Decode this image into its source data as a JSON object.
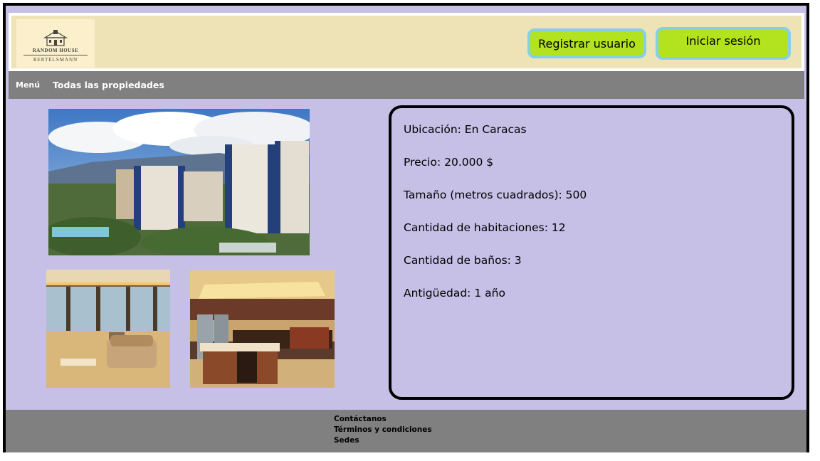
{
  "header": {
    "logo": {
      "line1": "RANDOM HOUSE",
      "line2": "BERTELSMANN",
      "icon": "house-logo-icon"
    },
    "register_label": "Registrar usuario",
    "login_label": "Iniciar sesión",
    "colors": {
      "header_bg": "#ede3b6",
      "button_bg": "#b3e21e",
      "button_border": "#86cfe6"
    }
  },
  "nav": {
    "menu_label": "Menú",
    "all_properties_label": "Todas las propiedades"
  },
  "gallery": {
    "images": [
      "building-exterior-photo",
      "living-room-photo",
      "kitchen-photo"
    ]
  },
  "details": {
    "location": "Ubicación: En Caracas",
    "price": "Precio: 20.000 $",
    "size": "Tamaño (metros cuadrados): 500",
    "rooms": "Cantidad de habitaciones: 12",
    "bathrooms": "Cantidad de baños: 3",
    "age": "Antigüedad: 1 año"
  },
  "footer": {
    "contact": "Contáctanos",
    "terms": "Términos y condiciones",
    "branches": "Sedes"
  },
  "colors": {
    "page_bg": "#c6bfe6",
    "bar_bg": "#808080"
  }
}
